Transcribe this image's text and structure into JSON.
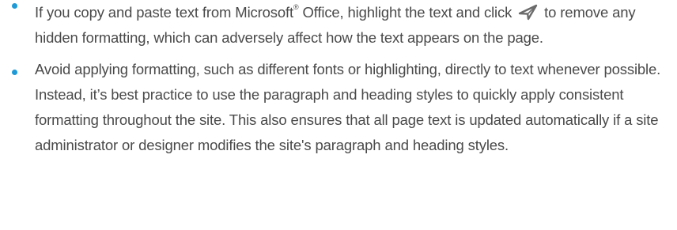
{
  "tips": [
    {
      "text_before_trademark": "If you copy and paste text from Microsoft",
      "trademark": "®",
      "text_before_icon": " Office, highlight the text and click ",
      "icon": "clear-formatting-icon",
      "text_after_icon": " to remove any hidden formatting, which can adversely affect how the text appears on the page."
    },
    {
      "text": "Avoid applying formatting, such as different fonts or highlighting, directly to text whenever possible. Instead, it’s best practice to use the paragraph and heading styles to quickly apply consistent formatting throughout the site. This also ensures that all page text is updated automatically if a site administrator or designer modifies the site's paragraph and heading styles."
    }
  ],
  "colors": {
    "bullet": "#1f9ad6",
    "text": "#4a4a4a",
    "icon": "#6b6b6b"
  }
}
